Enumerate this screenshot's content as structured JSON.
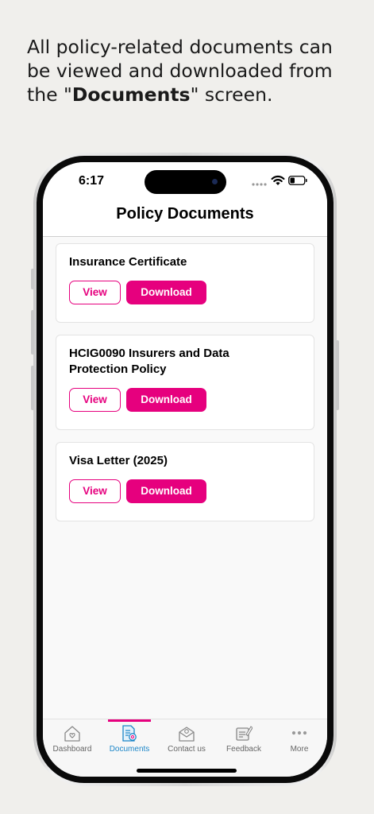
{
  "caption": {
    "before": "All policy-related documents can be viewed and downloaded from the \"",
    "bold": "Documents",
    "after": "\" screen."
  },
  "status_bar": {
    "time": "6:17"
  },
  "header": {
    "title": "Policy Documents"
  },
  "documents": [
    {
      "title": "Insurance Certificate",
      "view_label": "View",
      "download_label": "Download"
    },
    {
      "title": "HCIG0090 Insurers and Data Protection Policy",
      "view_label": "View",
      "download_label": "Download"
    },
    {
      "title": "Visa Letter (2025)",
      "view_label": "View",
      "download_label": "Download"
    }
  ],
  "tabbar": {
    "items": [
      {
        "label": "Dashboard",
        "icon": "home-heart-icon"
      },
      {
        "label": "Documents",
        "icon": "document-search-icon",
        "active": true
      },
      {
        "label": "Contact us",
        "icon": "envelope-at-icon"
      },
      {
        "label": "Feedback",
        "icon": "feedback-pen-icon"
      },
      {
        "label": "More",
        "icon": "more-dots-icon"
      }
    ]
  },
  "colors": {
    "accent": "#e6007e",
    "active_tab": "#1c86c8"
  }
}
